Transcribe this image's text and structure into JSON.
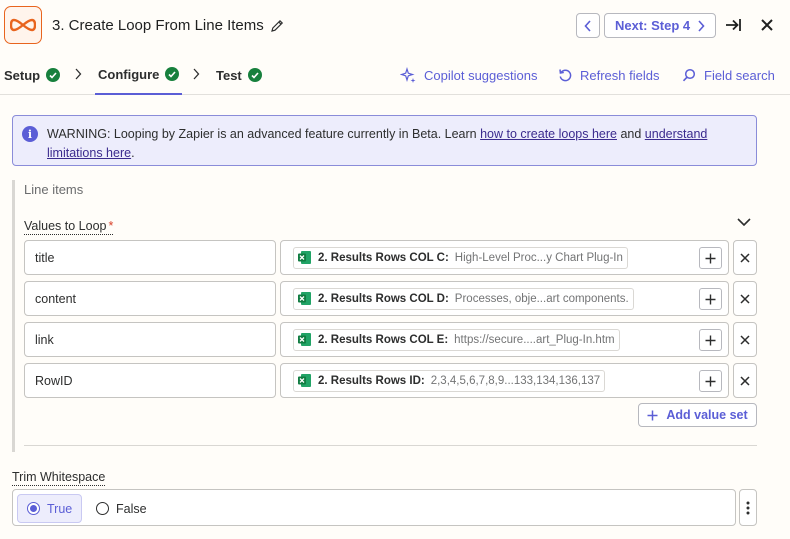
{
  "header": {
    "title": "3. Create Loop From Line Items",
    "next_label": "Next: Step 4",
    "brand_color": "#e8641e"
  },
  "tabs": [
    {
      "label": "Setup",
      "status": "complete"
    },
    {
      "label": "Configure",
      "status": "complete",
      "active": true
    },
    {
      "label": "Test",
      "status": "complete"
    }
  ],
  "toolbar": {
    "copilot": "Copilot suggestions",
    "refresh": "Refresh fields",
    "search": "Field search"
  },
  "warning": {
    "prefix": "WARNING: Looping by Zapier is an advanced feature currently in Beta. Learn ",
    "link1": "how to create loops here",
    "middle": " and ",
    "link2a": "understand",
    "link2b": "limitations here",
    "suffix": "."
  },
  "section": {
    "title": "Line items",
    "loop_label": "Values to Loop",
    "required_mark": "*",
    "add_value_set": "Add value set"
  },
  "rows": [
    {
      "key": "title",
      "field": "2. Results Rows COL C:",
      "sample": "High-Level Proc...y Chart Plug-In"
    },
    {
      "key": "content",
      "field": "2. Results Rows COL D:",
      "sample": "Processes, obje...art components."
    },
    {
      "key": "link",
      "field": "2. Results Rows COL E:",
      "sample": "https://secure....art_Plug-In.htm"
    },
    {
      "key": "RowID",
      "field": "2. Results Rows ID:",
      "sample": "2,3,4,5,6,7,8,9...133,134,136,137"
    }
  ],
  "trim": {
    "label": "Trim Whitespace",
    "options": [
      "True",
      "False"
    ],
    "selected": "True"
  },
  "colors": {
    "accent": "#5b5ed6",
    "success": "#17803d",
    "warning_bg": "#ededfc"
  }
}
